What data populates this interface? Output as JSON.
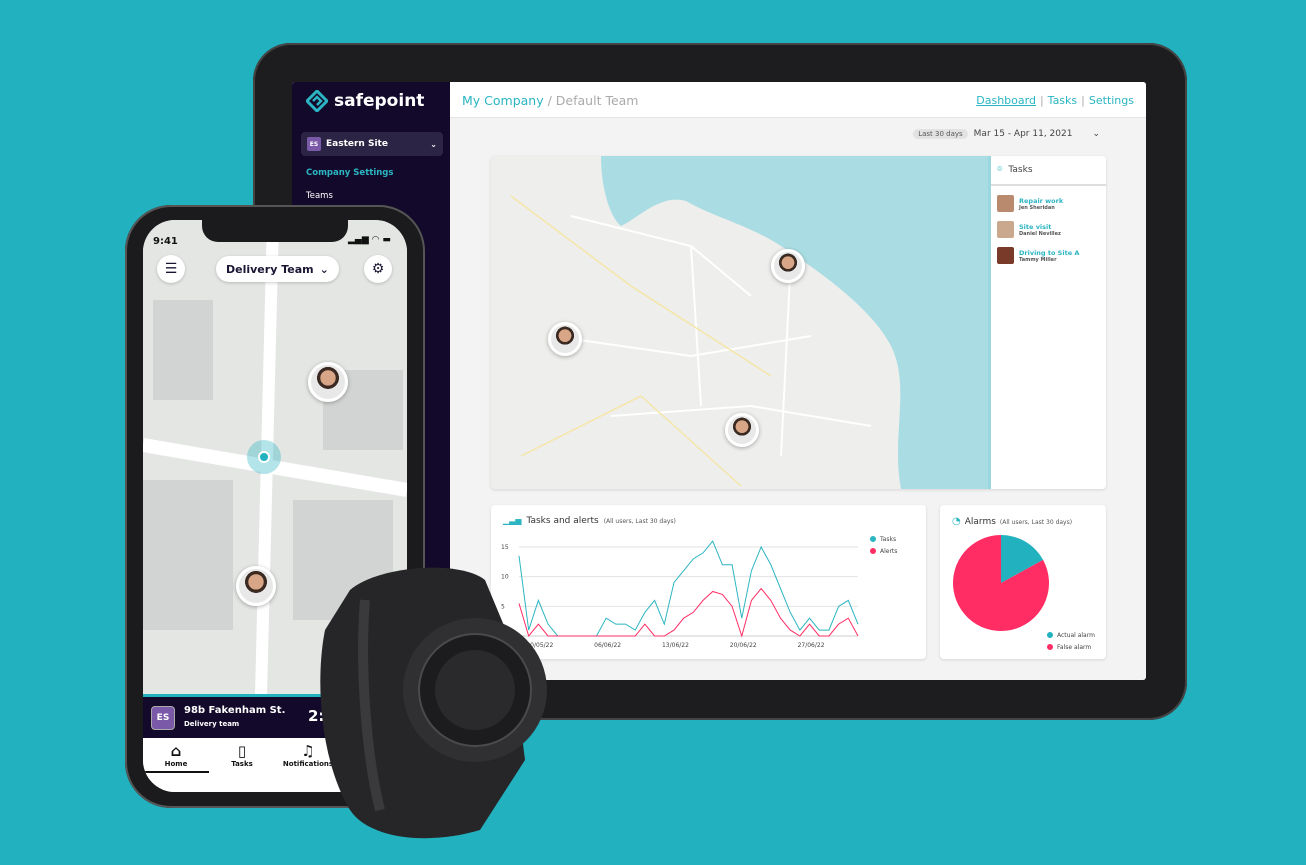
{
  "tablet": {
    "brand": "safepoint",
    "site_selector": {
      "badge": "ES",
      "label": "Eastern Site"
    },
    "sidebar_links": [
      "Company Settings",
      "Teams"
    ],
    "breadcrumb": {
      "company": "My Company",
      "separator": " / ",
      "team": "Default Team"
    },
    "nav": {
      "dashboard": "Dashboard",
      "tasks": "Tasks",
      "settings": "Settings",
      "separator": "|"
    },
    "date_range": {
      "preset": "Last 30 days",
      "range": "Mar 15 - Apr 11, 2021"
    },
    "tasks_panel": {
      "title": "Tasks",
      "items": [
        {
          "title": "Repair work",
          "person": "Jen Sheridan"
        },
        {
          "title": "Site visit",
          "person": "Daniel Nevillez"
        },
        {
          "title": "Driving to Site A",
          "person": "Tammy Miller"
        }
      ]
    },
    "colors": {
      "accent": "#2bb5c2",
      "alert": "#ff2d64",
      "sidebar": "#130a2b",
      "background": "#22b1bf"
    }
  },
  "chart_data": [
    {
      "type": "line",
      "title": "Tasks and alerts",
      "subtitle": "(All users, Last 30 days)",
      "x_tick_labels": [
        "30/05/22",
        "06/06/22",
        "13/06/22",
        "20/06/22",
        "27/06/22"
      ],
      "y_ticks": [
        5,
        10,
        15
      ],
      "ylim": [
        0,
        16
      ],
      "legend_position": "top-right",
      "grid": "horizontal",
      "x": [
        "28/05",
        "29/05",
        "30/05",
        "31/05",
        "01/06",
        "02/06",
        "03/06",
        "04/06",
        "05/06",
        "06/06",
        "07/06",
        "08/06",
        "09/06",
        "10/06",
        "11/06",
        "12/06",
        "13/06",
        "14/06",
        "15/06",
        "16/06",
        "17/06",
        "18/06",
        "19/06",
        "20/06",
        "21/06",
        "22/06",
        "23/06",
        "24/06",
        "25/06",
        "26/06",
        "27/06",
        "28/06",
        "29/06",
        "30/06",
        "01/07",
        "02/07"
      ],
      "series": [
        {
          "name": "Tasks",
          "color": "#2bb5c2",
          "values": [
            13.5,
            1,
            6,
            2,
            0,
            0,
            0,
            0,
            0,
            3,
            2,
            2,
            1,
            4,
            6,
            2,
            9,
            11,
            13,
            14,
            16,
            12,
            12,
            3,
            11,
            15,
            12,
            8,
            4,
            1,
            3,
            1,
            1,
            5,
            6,
            2
          ]
        },
        {
          "name": "Alerts",
          "color": "#ff2d64",
          "values": [
            5.5,
            0,
            2,
            0,
            0,
            0,
            0,
            0,
            0,
            0,
            0,
            0,
            0,
            2,
            0,
            0,
            1,
            3,
            4,
            6,
            7.5,
            7,
            5,
            0,
            6,
            8,
            6,
            3,
            1,
            0,
            2,
            0,
            0,
            2,
            3,
            0
          ]
        }
      ]
    },
    {
      "type": "pie",
      "title": "Alarms",
      "subtitle": "(All users, Last 30 days)",
      "legend_position": "bottom-right",
      "slices": [
        {
          "name": "Actual alarm",
          "value": 17,
          "color": "#22b1bf"
        },
        {
          "name": "False alarm",
          "value": 83,
          "color": "#ff2d64"
        }
      ]
    }
  ],
  "phone": {
    "time": "9:41",
    "team_selector": "Delivery Team",
    "location_bar": {
      "badge": "ES",
      "address": "98b Fakenham St.",
      "team": "Delivery team",
      "time": "2:2"
    },
    "tabs": [
      {
        "label": "Home",
        "icon": "home-icon"
      },
      {
        "label": "Tasks",
        "icon": "clipboard-icon"
      },
      {
        "label": "Notifications",
        "icon": "bell-icon"
      }
    ]
  }
}
